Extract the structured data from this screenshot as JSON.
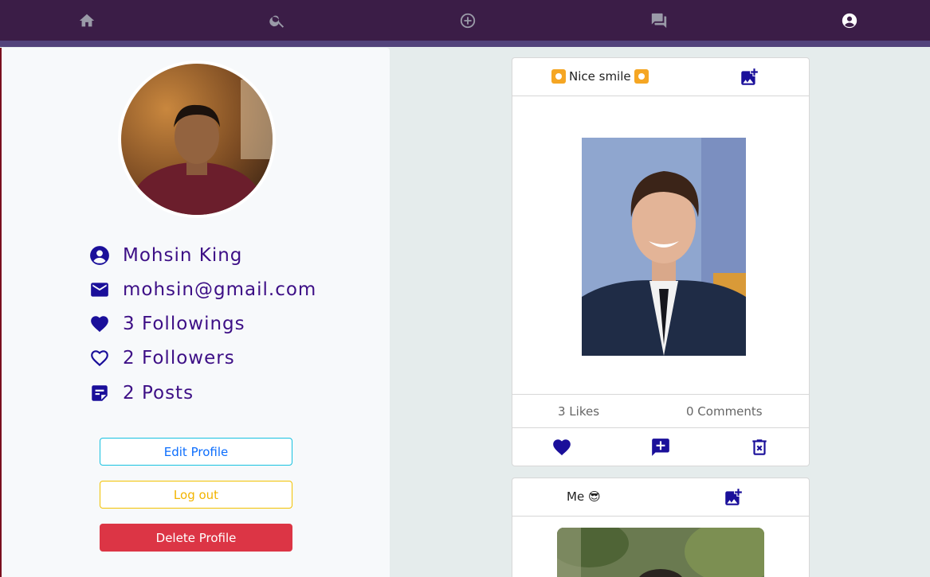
{
  "nav": {
    "items": [
      {
        "name": "home",
        "icon": "home-icon"
      },
      {
        "name": "search",
        "icon": "search-icon"
      },
      {
        "name": "add-post",
        "icon": "add-circle-icon"
      },
      {
        "name": "messages",
        "icon": "chat-icon"
      },
      {
        "name": "profile",
        "icon": "account-icon"
      }
    ]
  },
  "profile": {
    "name": "Mohsin King",
    "email": "mohsin@gmail.com",
    "followings": "3 Followings",
    "followers": "2 Followers",
    "posts": "2 Posts",
    "edit_label": "Edit Profile",
    "logout_label": "Log out",
    "delete_label": "Delete Profile"
  },
  "posts": [
    {
      "caption": "Nice smile",
      "likes": "3 Likes",
      "comments": "0 Comments"
    },
    {
      "caption": "Me 😎"
    }
  ],
  "colors": {
    "nav_bg": "#3b1d47",
    "accent": "#3d0f86",
    "icon": "#1a0f9a",
    "danger": "#dc3545"
  }
}
